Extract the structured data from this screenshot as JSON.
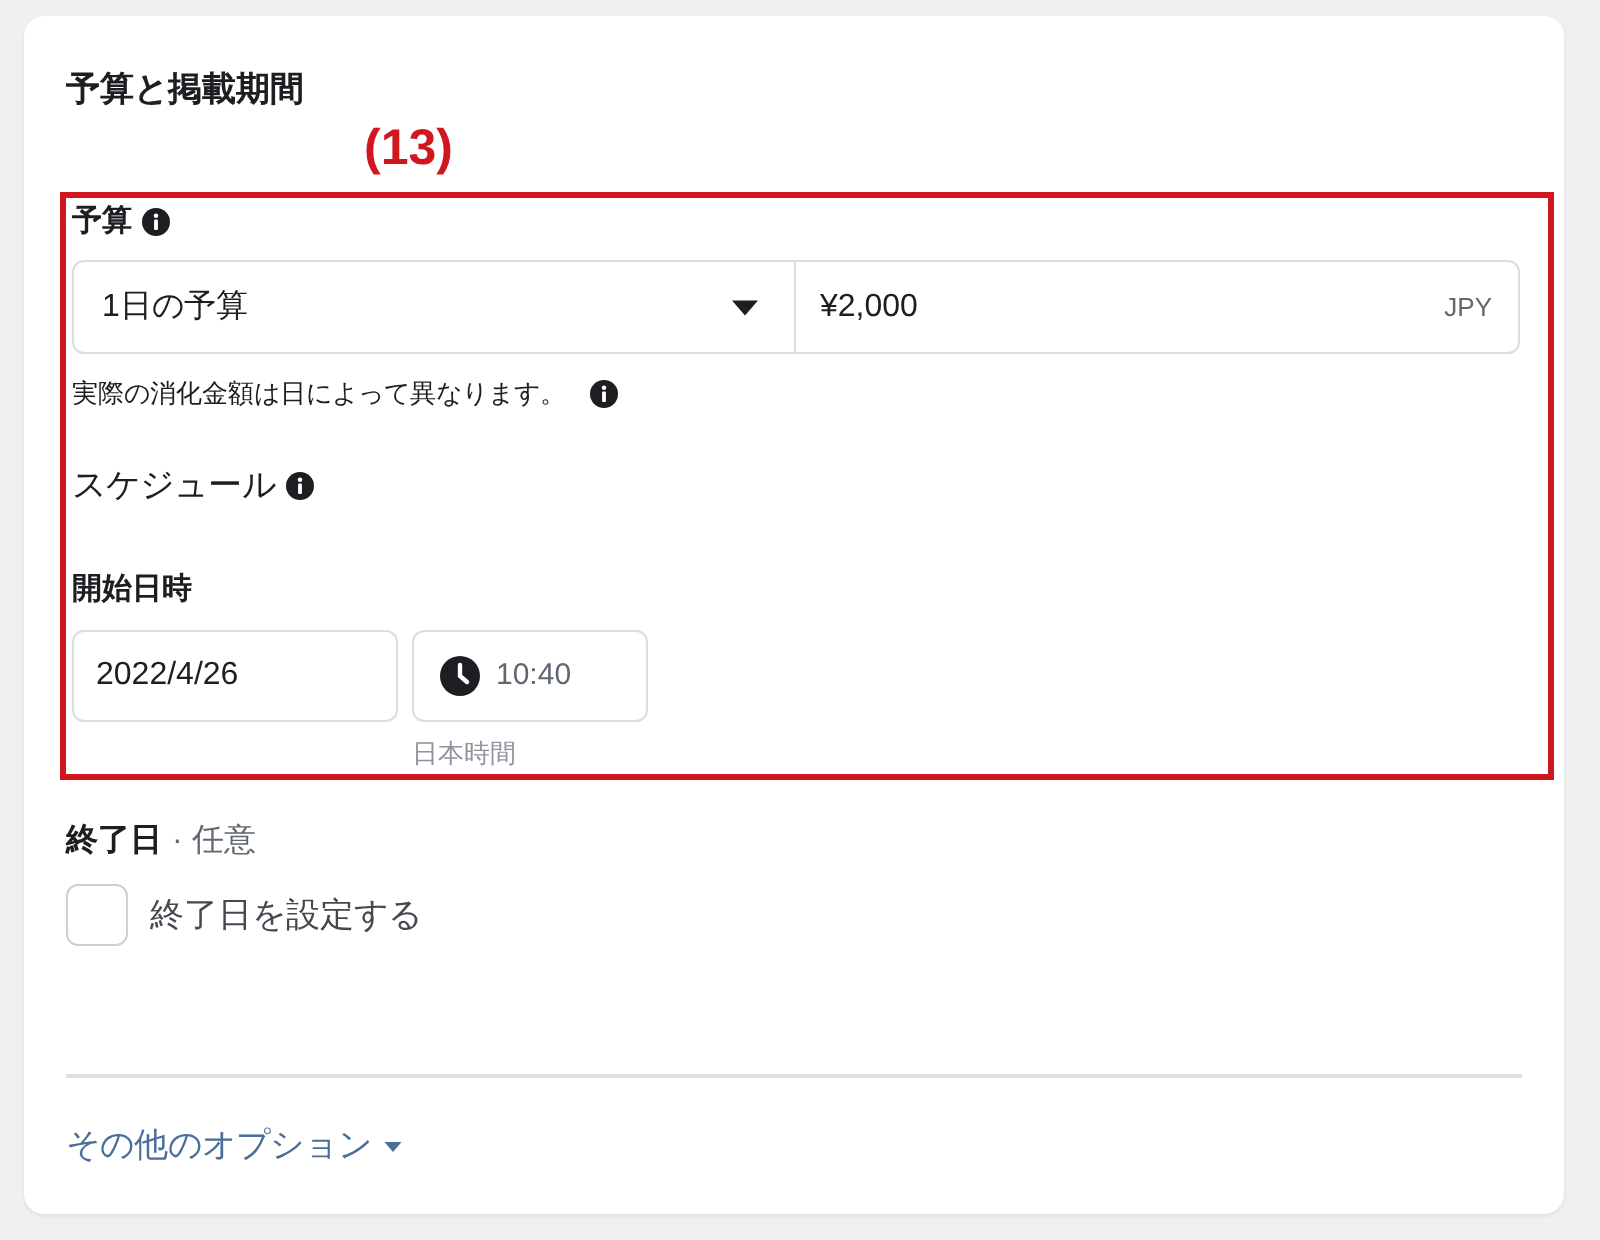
{
  "panel": {
    "title": "予算と掲載期間"
  },
  "annotation": {
    "label": "(13)"
  },
  "budget": {
    "label": "予算",
    "type_select": {
      "value": "1日の予算"
    },
    "amount": {
      "value": "¥2,000",
      "currency": "JPY"
    },
    "note": "実際の消化金額は日によって異なります。"
  },
  "schedule": {
    "label": "スケジュール",
    "start": {
      "label": "開始日時",
      "date": "2022/4/26",
      "time": "10:40",
      "timezone": "日本時間"
    }
  },
  "end_date": {
    "label": "終了日",
    "optional": "· 任意",
    "checkbox": {
      "label": "終了日を設定する",
      "checked": false
    }
  },
  "more_options": {
    "label": "その他のオプション"
  }
}
